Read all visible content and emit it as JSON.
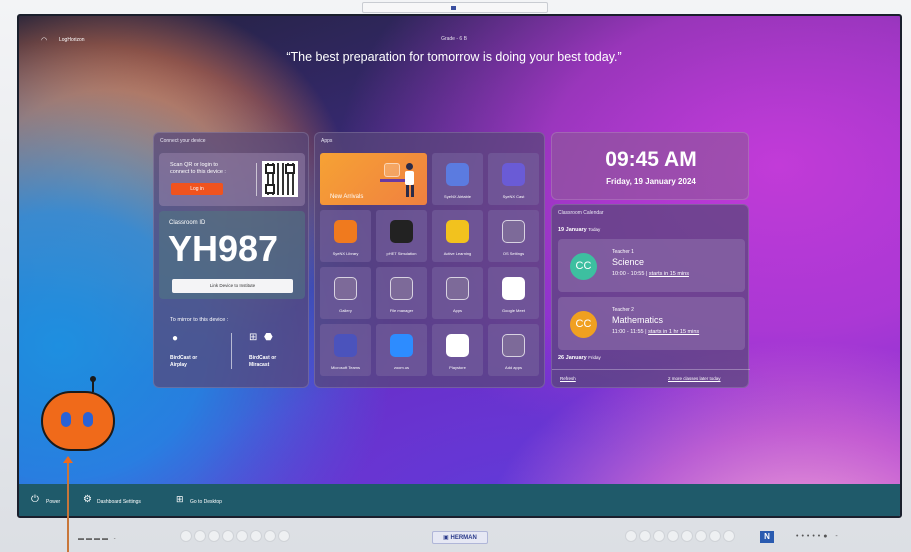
{
  "header": {
    "brand": "LogHorizon",
    "grade": "Grade - 6 B",
    "quote": "“The best preparation for tomorrow is doing your best today.”"
  },
  "connect_panel": {
    "title": "Connect your device",
    "scan_text_line1": "Scan QR or login to",
    "scan_text_line2": "connect to this device :",
    "login_label": "Log in",
    "classroom_id_label": "Classroom ID",
    "classroom_id": "YH987",
    "link_label": "Link Device to Institute",
    "mirror_label": "To mirror to this device :",
    "mirror_apple_line1": "BirdCast or",
    "mirror_apple_line2": "Airplay",
    "mirror_win_line1": "BirdCast or",
    "mirror_win_line2": "Miracast"
  },
  "apps_panel": {
    "title": "Apps",
    "featured_label": "New Arrivals",
    "apps": [
      {
        "label": "SyeNX Airtable",
        "color": "#5b7be0"
      },
      {
        "label": "SyeNX Cast",
        "color": "#6a5bd6"
      },
      {
        "label": "SyeNX Library",
        "color": "#f07a1e"
      },
      {
        "label": "pHET Simulation",
        "color": "#222222"
      },
      {
        "label": "Active Learning",
        "color": "#f2c21e"
      },
      {
        "label": "OS Settings",
        "color": "#7d6a99"
      },
      {
        "label": "Gallery",
        "color": "#7d6a99"
      },
      {
        "label": "File manager",
        "color": "#7d6a99"
      },
      {
        "label": "Apps",
        "color": "#7d6a99"
      },
      {
        "label": "Google Meet",
        "color": "#ffffff"
      },
      {
        "label": "Microsoft Teams",
        "color": "#4b53bc"
      },
      {
        "label": "zoom.us",
        "color": "#2d8cff"
      },
      {
        "label": "Playstore",
        "color": "#ffffff"
      },
      {
        "label": "Add apps",
        "color": "#7d6a99"
      }
    ]
  },
  "clock": {
    "time": "09:45 AM",
    "date": "Friday, 19 January 2024"
  },
  "calendar": {
    "title": "Classroom Calendar",
    "day1": "19 January",
    "day1_sub": "Today",
    "events": [
      {
        "initials": "CC",
        "teacher": "Teacher 1",
        "subject": "Science",
        "time": "10:00 - 10:55 |",
        "starts": "starts in 15 mins",
        "color": "#3dbfa0"
      },
      {
        "initials": "CC",
        "teacher": "Teacher 2",
        "subject": "Mathematics",
        "time": "11:00 - 11:55 |",
        "starts": "starts in 1 hr 15 mins",
        "color": "#f0a020"
      }
    ],
    "day2": "26 January",
    "day2_sub": "Friday",
    "refresh": "Refresh",
    "more": "2 more classes later today"
  },
  "bottom_bar": {
    "power": "Power",
    "dashboard": "Dashboard Settings",
    "desktop": "Go to Desktop"
  },
  "bezel": {
    "brand": "HERMAN"
  }
}
